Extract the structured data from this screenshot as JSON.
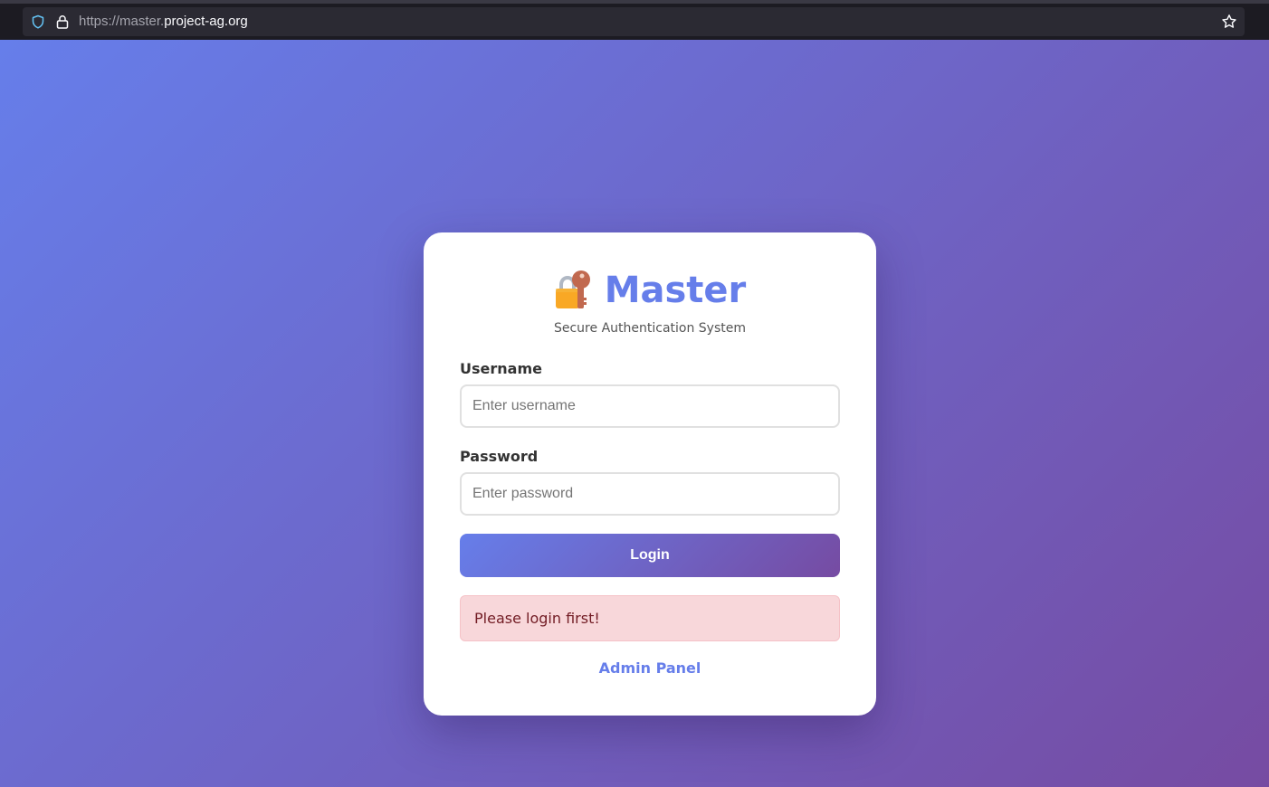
{
  "browser": {
    "url_prefix": "https://master.",
    "url_domain": "project-ag.org",
    "icons": [
      "shield-icon",
      "lock-icon",
      "bookmark-star-icon"
    ]
  },
  "login": {
    "title": "Master",
    "brand_icon": "locked-with-key-icon",
    "subtitle": "Secure Authentication System",
    "username_label": "Username",
    "username_placeholder": "Enter username",
    "username_value": "",
    "password_label": "Password",
    "password_placeholder": "Enter password",
    "password_value": "",
    "submit_label": "Login",
    "alert_message": "Please login first!",
    "admin_link": "Admin Panel"
  },
  "colors": {
    "accent": "#667eea",
    "gradient_end": "#764ba2",
    "alert_bg": "#f8d7da",
    "alert_text": "#721c24"
  }
}
